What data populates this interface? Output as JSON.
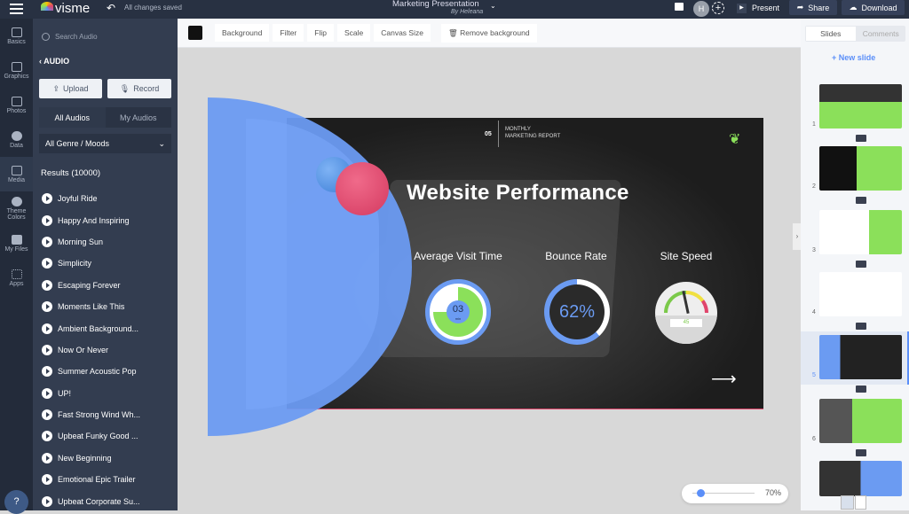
{
  "topbar": {
    "brand": "visme",
    "save_status": "All changes saved",
    "doc_title": "Marketing Presentation",
    "doc_author": "By Heleana",
    "avatar_initial": "H",
    "present": "Present",
    "share": "Share",
    "download": "Download"
  },
  "rail": [
    {
      "label": "Basics"
    },
    {
      "label": "Graphics"
    },
    {
      "label": "Photos"
    },
    {
      "label": "Data"
    },
    {
      "label": "Media"
    },
    {
      "label": "Theme Colors"
    },
    {
      "label": "My Files"
    },
    {
      "label": "Apps"
    }
  ],
  "help": "?",
  "panel": {
    "search_placeholder": "Search Audio",
    "back": "AUDIO",
    "upload": "Upload",
    "record": "Record",
    "tabs": [
      "All Audios",
      "My Audios"
    ],
    "genre": "All Genre / Moods",
    "results": "Results (10000)",
    "tracks": [
      "Joyful Ride",
      "Happy And Inspiring",
      "Morning Sun",
      "Simplicity",
      "Escaping Forever",
      "Moments Like This",
      "Ambient Background...",
      "Now Or Never",
      "Summer Acoustic Pop",
      "UP!",
      "Fast Strong Wind Wh...",
      "Upbeat Funky Good ...",
      "New Beginning",
      "Emotional Epic Trailer",
      "Upbeat Corporate Su..."
    ]
  },
  "toolbar": {
    "color": "#111111",
    "items": [
      "Background",
      "Filter",
      "Flip",
      "Scale",
      "Canvas Size"
    ],
    "remove_bg": "Remove background"
  },
  "slide": {
    "number": "05",
    "kicker1": "MONTHLY",
    "kicker2": "MARKETING REPORT",
    "title": "Website Performance",
    "metrics": [
      {
        "label": "Average Visit Time",
        "value": "03",
        "unit": "min"
      },
      {
        "label": "Bounce Rate",
        "value": "62%",
        "percent": 62
      },
      {
        "label": "Site Speed",
        "value": "45"
      }
    ]
  },
  "zoom": {
    "value": "70%",
    "level": 0.1
  },
  "right": {
    "tabs": [
      "Slides",
      "Comments"
    ],
    "new_slide": "+ New slide",
    "slides": [
      "1",
      "2",
      "3",
      "4",
      "5",
      "6"
    ],
    "active_slide": "5"
  },
  "colors": {
    "accent": "#5b8ff9",
    "green": "#8be05a",
    "pink": "#e0456b",
    "dark": "#283142"
  }
}
